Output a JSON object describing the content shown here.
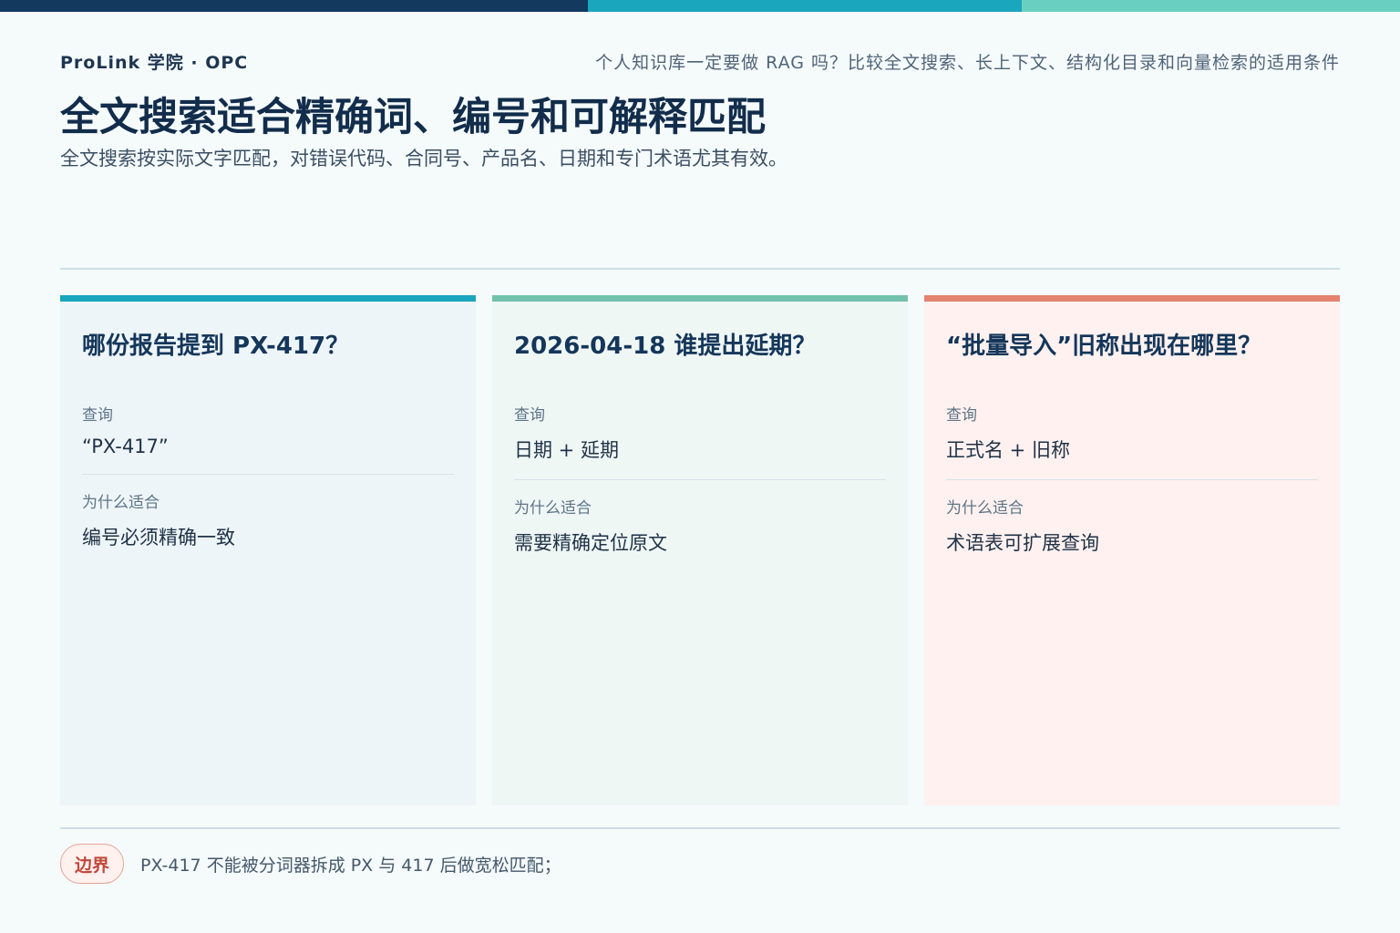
{
  "header": {
    "brand": "ProLink 学院 · OPC",
    "series_title": "个人知识库一定要做 RAG 吗？比较全文搜索、长上下文、结构化目录和向量检索的适用条件"
  },
  "main": {
    "title": "全文搜索适合精确词、编号和可解释匹配",
    "subtitle": "全文搜索按实际文字匹配，对错误代码、合同号、产品名、日期和专门术语尤其有效。"
  },
  "colors": {
    "navy": "#133a5e",
    "teal": "#1aa6bd",
    "mint": "#69d0c1",
    "green": "#72c1ad",
    "coral": "#e4826f"
  },
  "cards": [
    {
      "question": "哪份报告提到 PX-417？",
      "query_label": "查询",
      "query_value": "“PX-417”",
      "reason_label": "为什么适合",
      "reason_value": "编号必须精确一致"
    },
    {
      "question": "2026-04-18 谁提出延期？",
      "query_label": "查询",
      "query_value": "日期 + 延期",
      "reason_label": "为什么适合",
      "reason_value": "需要精确定位原文"
    },
    {
      "question": "“批量导入”旧称出现在哪里？",
      "query_label": "查询",
      "query_value": "正式名 + 旧称",
      "reason_label": "为什么适合",
      "reason_value": "术语表可扩展查询"
    }
  ],
  "footer": {
    "badge": "边界",
    "note": "PX-417 不能被分词器拆成 PX 与 417 后做宽松匹配；"
  }
}
